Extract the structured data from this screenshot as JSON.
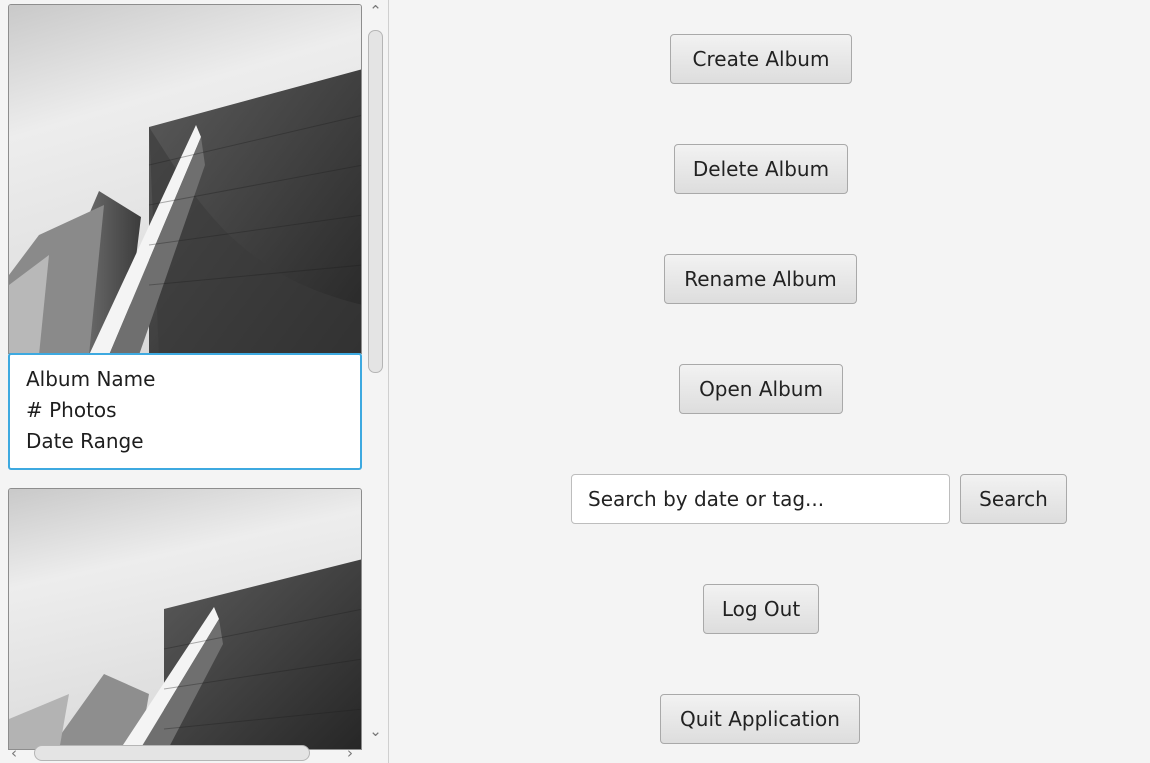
{
  "albums": [
    {
      "name": "Album Name",
      "photo_count": "# Photos",
      "date_range": "Date Range",
      "selected": true
    },
    {
      "selected": false
    }
  ],
  "buttons": {
    "create": "Create Album",
    "delete": "Delete Album",
    "rename": "Rename Album",
    "open": "Open Album",
    "search": "Search",
    "logout": "Log Out",
    "quit": "Quit Application"
  },
  "search": {
    "placeholder": "Search by date or tag..."
  },
  "scrollbar_icons": {
    "up": "chevron-up-icon",
    "down": "chevron-down-icon",
    "left": "chevron-left-icon",
    "right": "chevron-right-icon"
  },
  "colors": {
    "selection_border": "#3da9e0",
    "background": "#f4f4f4"
  }
}
